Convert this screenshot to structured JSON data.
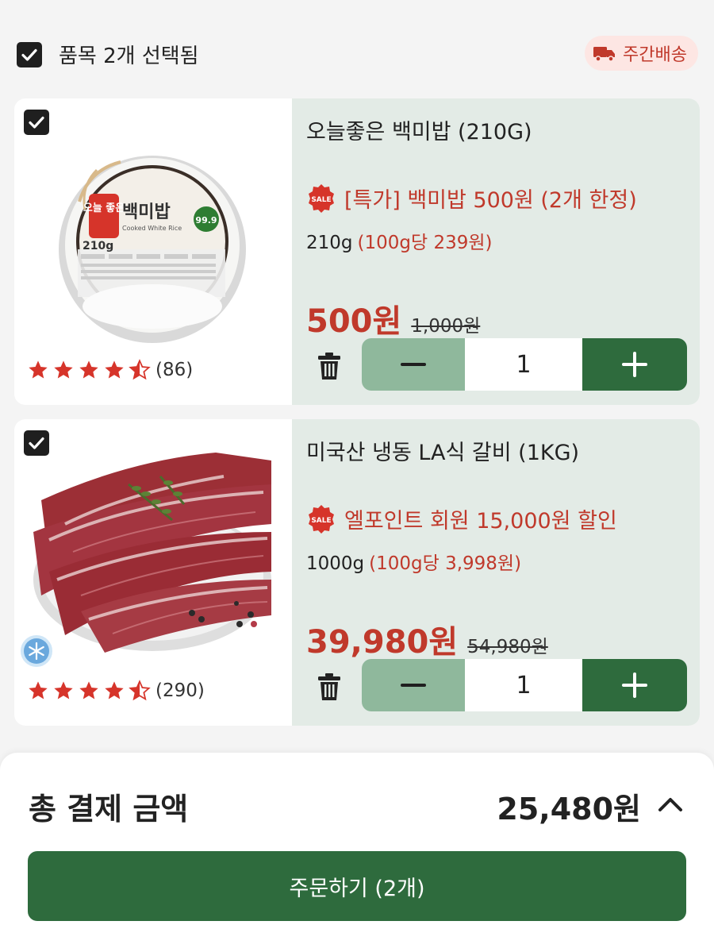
{
  "header": {
    "selection_label": "품목 2개 선택됨",
    "delivery_badge": "주간배송"
  },
  "items": [
    {
      "name": "오늘좋은 백미밥 (210G)",
      "promo": "[특가] 백미밥 500원 (2개 한정)",
      "weight": "210g",
      "unit_price": "(100g당 239원)",
      "price": "500원",
      "original_price": "1,000원",
      "quantity": "1",
      "rating": 4.5,
      "review_count": "(86)",
      "package_text": {
        "brand": "오늘 좋은",
        "title": "백미밥",
        "subtitle": "Cooked White Rice",
        "weight": "210g",
        "percent": "99.9"
      },
      "frozen": false
    },
    {
      "name": "미국산 냉동 LA식 갈비 (1KG)",
      "promo": "엘포인트 회원 15,000원 할인",
      "weight": "1000g",
      "unit_price": "(100g당 3,998원)",
      "price": "39,980원",
      "original_price": "54,980원",
      "quantity": "1",
      "rating": 4.5,
      "review_count": "(290)",
      "frozen": true
    }
  ],
  "footer": {
    "total_label": "총 결제 금액",
    "total_amount": "25,480원",
    "order_button": "주문하기 (2개)"
  },
  "colors": {
    "accent_green": "#2e6b3d",
    "light_green": "#8fb89c",
    "sale_red": "#c0392b",
    "panel_bg": "#e3ebe6"
  }
}
